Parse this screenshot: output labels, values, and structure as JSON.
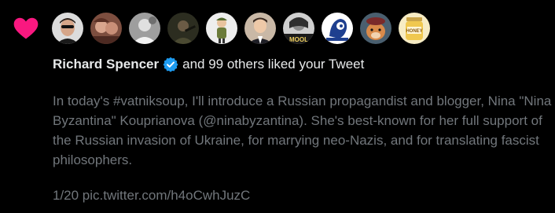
{
  "notification": {
    "type_icon": "heart-icon",
    "heart_color": "#f91880",
    "avatars": [
      {
        "name": "avatar-1",
        "bg": "#d9d9d9"
      },
      {
        "name": "avatar-2",
        "bg": "#8a5a48"
      },
      {
        "name": "avatar-3",
        "bg": "#bdbdbd"
      },
      {
        "name": "avatar-4",
        "bg": "#3a3b2a"
      },
      {
        "name": "avatar-5",
        "bg": "#e6e6e6"
      },
      {
        "name": "avatar-6",
        "bg": "#d8c6b4"
      },
      {
        "name": "avatar-7",
        "bg": "#cfcfcf",
        "label": "MOOL"
      },
      {
        "name": "avatar-8",
        "bg": "#ffffff"
      },
      {
        "name": "avatar-9",
        "bg": "#d37a3a"
      },
      {
        "name": "avatar-10",
        "bg": "#f2e3b0",
        "label": "HONEY"
      }
    ],
    "liker_name": "Richard Spencer",
    "verified_icon": "verified-badge-icon",
    "verified_color": "#1d9bf0",
    "liked_suffix": "and 99 others liked your Tweet",
    "tweet_text": "In today's #vatniksoup, I'll introduce a Russian propagandist and blogger, Nina \"Nina Byzantina\" Kouprianova (@ninabyzantina). She's best-known for her full support of the Russian invasion of Ukraine, for marrying neo-Nazis, and for translating fascist philosophers.",
    "tweet_footer": "1/20 pic.twitter.com/h4oCwhJuzC"
  }
}
